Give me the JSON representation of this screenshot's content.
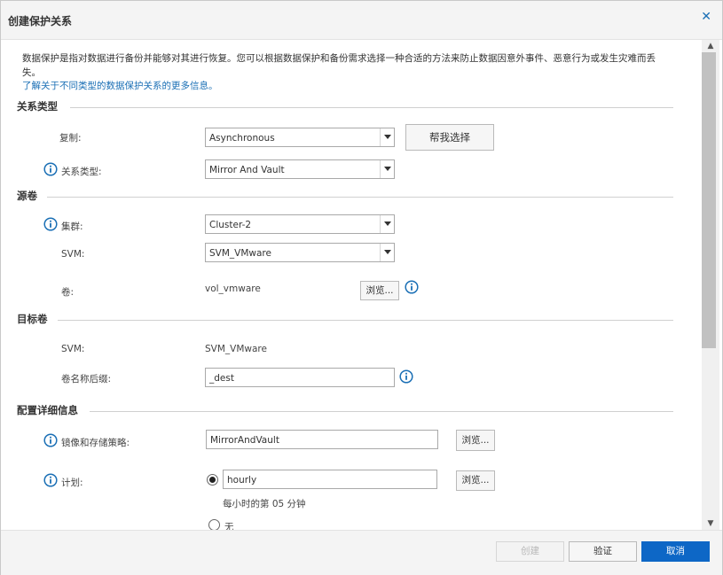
{
  "dialog": {
    "title": "创建保护关系",
    "close_icon": "close-icon"
  },
  "intro": {
    "text": "数据保护是指对数据进行备份并能够对其进行恢复。您可以根据数据保护和备份需求选择一种合适的方法来防止数据因意外事件、恶意行为或发生灾难而丢",
    "text_cont": "失。",
    "link": "了解关于不同类型的数据保护关系的更多信息。"
  },
  "relationship": {
    "section": "关系类型",
    "replication_label": "复制:",
    "replication_value": "Asynchronous",
    "help_button": "帮我选择",
    "type_label": "关系类型:",
    "type_value": "Mirror And Vault"
  },
  "source": {
    "section": "源卷",
    "cluster_label": "集群:",
    "cluster_value": "Cluster-2",
    "svm_label": "SVM:",
    "svm_value": "SVM_VMware",
    "volume_label": "卷:",
    "volume_value": "vol_vmware",
    "browse_label": "浏览..."
  },
  "destination": {
    "section": "目标卷",
    "svm_label": "SVM:",
    "svm_value": "SVM_VMware",
    "suffix_label": "卷名称后缀:",
    "suffix_value": "_dest"
  },
  "config": {
    "section": "配置详细信息",
    "policy_label": "镜像和存储策略:",
    "policy_value": "MirrorAndVault",
    "policy_browse": "浏览...",
    "schedule_label": "计划:",
    "schedule_value": "hourly",
    "schedule_browse": "浏览...",
    "schedule_desc": "每小时的第 05 分钟",
    "none_label": "无"
  },
  "footer": {
    "create": "创建",
    "validate": "验证",
    "cancel": "取消"
  },
  "colors": {
    "accent": "#0d67c6",
    "link": "#1a6fb5",
    "info": "#1a6fb5"
  }
}
